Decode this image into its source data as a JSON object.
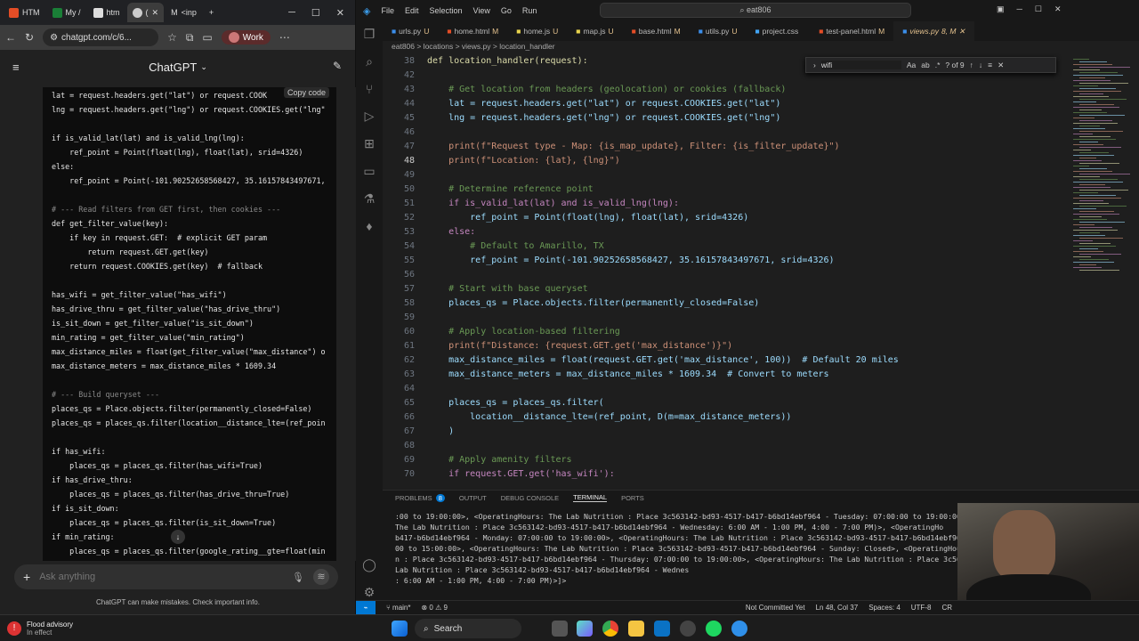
{
  "browser": {
    "tabs": [
      {
        "label": "HTM"
      },
      {
        "label": "My /"
      },
      {
        "label": "htm"
      },
      {
        "label": "( "
      },
      {
        "label": "<inp"
      }
    ],
    "url": "chatgpt.com/c/6...",
    "profile": "Work"
  },
  "chat": {
    "title": "ChatGPT",
    "copy_label": "Copy code",
    "ask_placeholder": "Ask anything",
    "disclaimer": "ChatGPT can make mistakes. Check important info."
  },
  "chat_code": [
    "lat = request.headers.get(\"lat\") or request.COOK",
    "lng = request.headers.get(\"lng\") or request.COOKIES.get(\"lng\"",
    "",
    "if is_valid_lat(lat) and is_valid_lng(lng):",
    "    ref_point = Point(float(lng), float(lat), srid=4326)",
    "else:",
    "    ref_point = Point(-101.90252658568427, 35.16157843497671,",
    "",
    "# --- Read filters from GET first, then cookies ---",
    "def get_filter_value(key):",
    "    if key in request.GET:  # explicit GET param",
    "        return request.GET.get(key)",
    "    return request.COOKIES.get(key)  # fallback",
    "",
    "has_wifi = get_filter_value(\"has_wifi\")",
    "has_drive_thru = get_filter_value(\"has_drive_thru\")",
    "is_sit_down = get_filter_value(\"is_sit_down\")",
    "min_rating = get_filter_value(\"min_rating\")",
    "max_distance_miles = float(get_filter_value(\"max_distance\") o",
    "max_distance_meters = max_distance_miles * 1609.34",
    "",
    "# --- Build queryset ---",
    "places_qs = Place.objects.filter(permanently_closed=False)",
    "places_qs = places_qs.filter(location__distance_lte=(ref_poin",
    "",
    "if has_wifi:",
    "    places_qs = places_qs.filter(has_wifi=True)",
    "if has_drive_thru:",
    "    places_qs = places_qs.filter(has_drive_thru=True)",
    "if is_sit_down:",
    "    places_qs = places_qs.filter(is_sit_down=True)",
    "if min_rating:",
    "    places_qs = places_qs.filter(google_rating__gte=float(min"
  ],
  "vscode": {
    "menu": [
      "File",
      "Edit",
      "Selection",
      "View",
      "Go",
      "Run"
    ],
    "search": "eat806",
    "tabs": [
      {
        "label": "urls.py",
        "mark": "U"
      },
      {
        "label": "home.html",
        "mark": "M"
      },
      {
        "label": "home.js",
        "mark": "U"
      },
      {
        "label": "map.js",
        "mark": "U"
      },
      {
        "label": "base.html",
        "mark": "M"
      },
      {
        "label": "utils.py",
        "mark": "U"
      },
      {
        "label": "project.css",
        "mark": ""
      },
      {
        "label": "test-panel.html",
        "mark": "M"
      },
      {
        "label": "views.py",
        "mark": "8, M"
      }
    ],
    "breadcrumb": "eat806 > locations > views.py > location_handler",
    "find": {
      "value": "wifi",
      "count": "? of 9"
    },
    "code_lines": [
      {
        "n": "38",
        "t": "def location_handler(request):"
      },
      {
        "n": "42",
        "t": ""
      },
      {
        "n": "43",
        "t": "    # Get location from headers (geolocation) or cookies (fallback)"
      },
      {
        "n": "44",
        "t": "    lat = request.headers.get(\"lat\") or request.COOKIES.get(\"lat\")"
      },
      {
        "n": "45",
        "t": "    lng = request.headers.get(\"lng\") or request.COOKIES.get(\"lng\")"
      },
      {
        "n": "46",
        "t": ""
      },
      {
        "n": "47",
        "t": "    print(f\"Request type - Map: {is_map_update}, Filter: {is_filter_update}\")"
      },
      {
        "n": "48",
        "t": "    print(f\"Location: {lat}, {lng}\")"
      },
      {
        "n": "49",
        "t": ""
      },
      {
        "n": "50",
        "t": "    # Determine reference point"
      },
      {
        "n": "51",
        "t": "    if is_valid_lat(lat) and is_valid_lng(lng):"
      },
      {
        "n": "52",
        "t": "        ref_point = Point(float(lng), float(lat), srid=4326)"
      },
      {
        "n": "53",
        "t": "    else:"
      },
      {
        "n": "54",
        "t": "        # Default to Amarillo, TX"
      },
      {
        "n": "55",
        "t": "        ref_point = Point(-101.90252658568427, 35.16157843497671, srid=4326)"
      },
      {
        "n": "56",
        "t": ""
      },
      {
        "n": "57",
        "t": "    # Start with base queryset"
      },
      {
        "n": "58",
        "t": "    places_qs = Place.objects.filter(permanently_closed=False)"
      },
      {
        "n": "59",
        "t": ""
      },
      {
        "n": "60",
        "t": "    # Apply location-based filtering"
      },
      {
        "n": "61",
        "t": "    print(f\"Distance: {request.GET.get('max_distance')}\")"
      },
      {
        "n": "62",
        "t": "    max_distance_miles = float(request.GET.get('max_distance', 100))  # Default 20 miles"
      },
      {
        "n": "63",
        "t": "    max_distance_meters = max_distance_miles * 1609.34  # Convert to meters"
      },
      {
        "n": "64",
        "t": ""
      },
      {
        "n": "65",
        "t": "    places_qs = places_qs.filter("
      },
      {
        "n": "66",
        "t": "        location__distance_lte=(ref_point, D(m=max_distance_meters))"
      },
      {
        "n": "67",
        "t": "    )"
      },
      {
        "n": "68",
        "t": ""
      },
      {
        "n": "69",
        "t": "    # Apply amenity filters"
      },
      {
        "n": "70",
        "t": "    if request.GET.get('has_wifi'):"
      }
    ],
    "panel_tabs": [
      "PROBLEMS",
      "OUTPUT",
      "DEBUG CONSOLE",
      "TERMINAL",
      "PORTS"
    ],
    "problems_count": "8",
    "terminal_lines": [
      ":00 to 19:00:00>, <OperatingHours: The Lab Nutrition : Place 3c563142-bd93-4517-b417-b6bd14ebf964 - Tuesday: 07:00:00 to 19:00:00>, <Op",
      "The Lab Nutrition : Place 3c563142-bd93-4517-b417-b6bd14ebf964 - Wednesday: 6:00 AM - 1:00 PM, 4:00 - 7:00 PM)>, <OperatingHo",
      "b417-b6bd14ebf964 - Monday: 07:00:00 to 19:00:00>, <OperatingHours: The Lab Nutrition : Place 3c563142-bd93-4517-b417-b6bd14ebf964 - Sa",
      "00 to 15:00:00>, <OperatingHours: The Lab Nutrition : Place 3c563142-bd93-4517-b417-b6bd14ebf964 - Sunday: Closed>, <OperatingHou",
      "n : Place 3c563142-bd93-4517-b417-b6bd14ebf964 - Thursday: 07:00:00 to 19:00:00>, <OperatingHours: The Lab Nutrition : Place 3c563142-b",
      "Lab Nutrition : Place 3c563142-bd93-4517-b417-b6bd14ebf964 - Wednes",
      ": 6:00 AM - 1:00 PM, 4:00 - 7:00 PM)>]>"
    ],
    "status": {
      "branch": "main*",
      "errors": "0",
      "warnings": "9",
      "git": "Not Committed Yet",
      "position": "Ln 48, Col 37",
      "spaces": "Spaces: 4",
      "encoding": "UTF-8",
      "eol": "CR"
    }
  },
  "taskbar": {
    "weather_title": "Flood advisory",
    "weather_sub": "In effect",
    "search": "Search"
  }
}
